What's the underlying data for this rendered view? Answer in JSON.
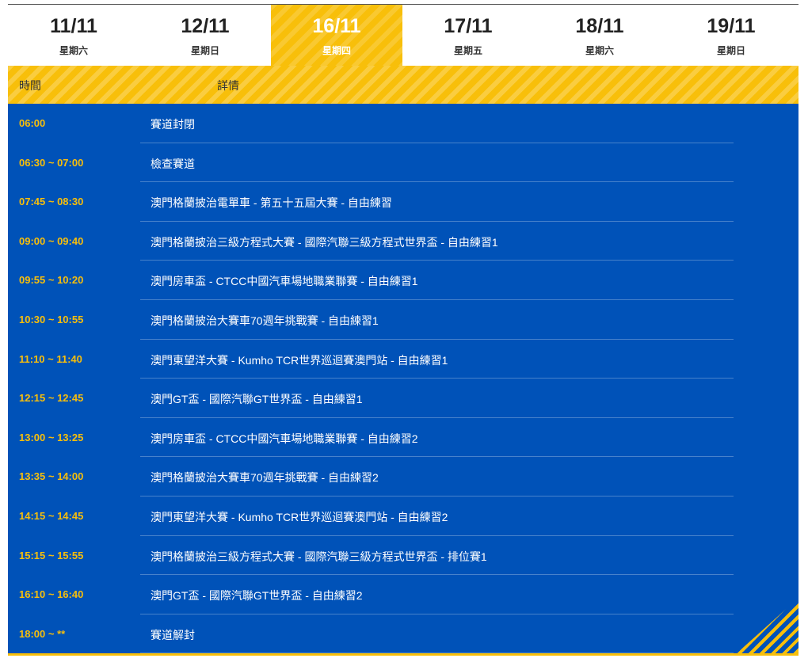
{
  "tabs": [
    {
      "date": "11/11",
      "weekday": "星期六"
    },
    {
      "date": "12/11",
      "weekday": "星期日"
    },
    {
      "date": "16/11",
      "weekday": "星期四"
    },
    {
      "date": "17/11",
      "weekday": "星期五"
    },
    {
      "date": "18/11",
      "weekday": "星期六"
    },
    {
      "date": "19/11",
      "weekday": "星期日"
    }
  ],
  "active_tab": "16/11",
  "header": {
    "time": "時間",
    "detail": "詳情"
  },
  "schedule": [
    {
      "time": "06:00",
      "detail": "賽道封閉"
    },
    {
      "time": "06:30 ~ 07:00",
      "detail": "檢查賽道"
    },
    {
      "time": "07:45 ~ 08:30",
      "detail": "澳門格蘭披治電單車 - 第五十五屆大賽 - 自由練習"
    },
    {
      "time": "09:00 ~ 09:40",
      "detail": "澳門格蘭披治三級方程式大賽 - 國際汽聯三級方程式世界盃 - 自由練習1"
    },
    {
      "time": "09:55 ~ 10:20",
      "detail": "澳門房車盃 - CTCC中國汽車場地職業聯賽 - 自由練習1"
    },
    {
      "time": "10:30 ~ 10:55",
      "detail": "澳門格蘭披治大賽車70週年挑戰賽 - 自由練習1"
    },
    {
      "time": "11:10 ~ 11:40",
      "detail": "澳門東望洋大賽 - Kumho TCR世界巡迴賽澳門站 - 自由練習1"
    },
    {
      "time": "12:15 ~ 12:45",
      "detail": "澳門GT盃 - 國際汽聯GT世界盃 - 自由練習1"
    },
    {
      "time": "13:00 ~ 13:25",
      "detail": "澳門房車盃 - CTCC中國汽車場地職業聯賽 - 自由練習2"
    },
    {
      "time": "13:35 ~ 14:00",
      "detail": "澳門格蘭披治大賽車70週年挑戰賽 - 自由練習2"
    },
    {
      "time": "14:15 ~ 14:45",
      "detail": "澳門東望洋大賽 - Kumho TCR世界巡迴賽澳門站 - 自由練習2"
    },
    {
      "time": "15:15 ~ 15:55",
      "detail": "澳門格蘭披治三級方程式大賽 - 國際汽聯三級方程式世界盃 - 排位賽1"
    },
    {
      "time": "16:10 ~ 16:40",
      "detail": "澳門GT盃 - 國際汽聯GT世界盃 - 自由練習2"
    },
    {
      "time": "18:00 ~ **",
      "detail": "賽道解封"
    }
  ],
  "colors": {
    "accent": "#f8bf0a",
    "panel": "#0052b8"
  }
}
